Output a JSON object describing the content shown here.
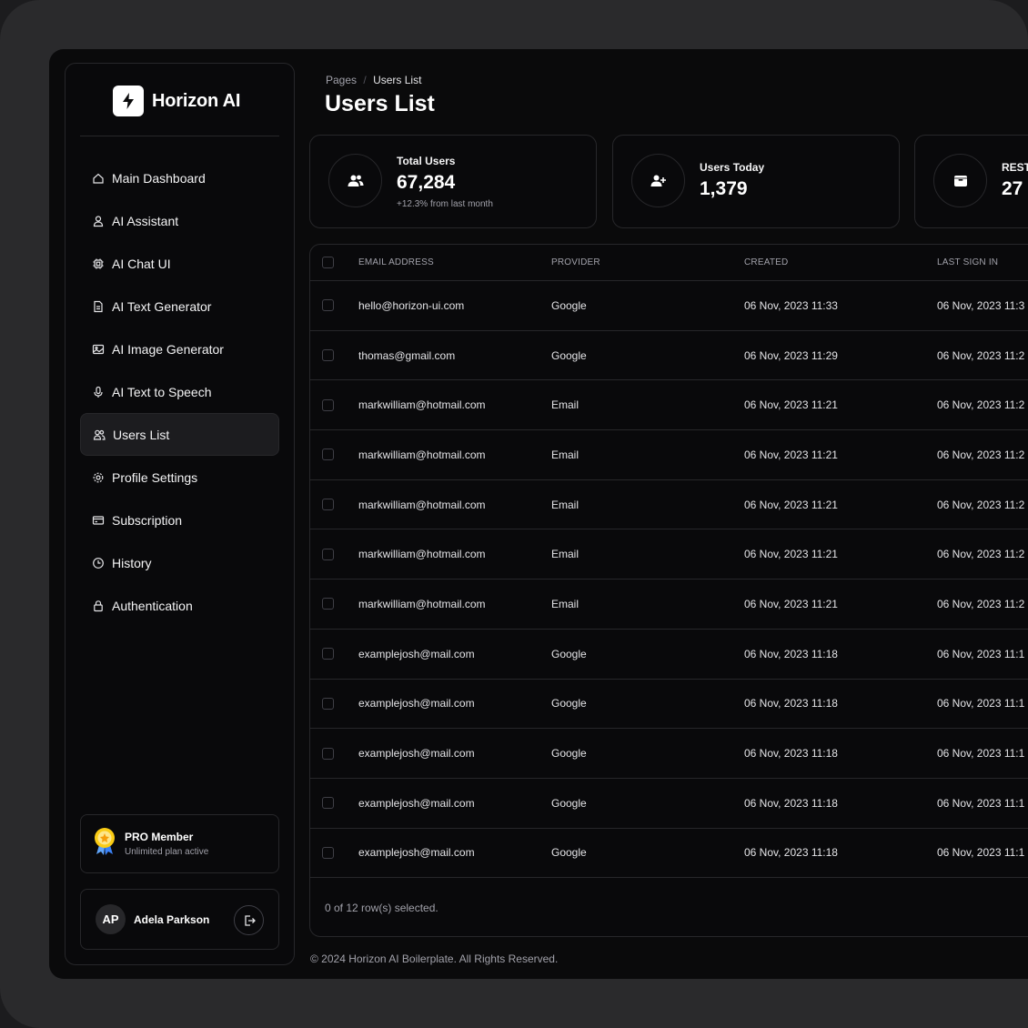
{
  "brand": {
    "name": "Horizon AI"
  },
  "nav": [
    {
      "label": "Main Dashboard",
      "icon": "home-icon"
    },
    {
      "label": "AI Assistant",
      "icon": "user-icon"
    },
    {
      "label": "AI Chat UI",
      "icon": "chip-icon"
    },
    {
      "label": "AI Text Generator",
      "icon": "document-icon"
    },
    {
      "label": "AI Image Generator",
      "icon": "image-icon"
    },
    {
      "label": "AI Text to Speech",
      "icon": "microphone-icon"
    },
    {
      "label": "Users List",
      "icon": "users-icon",
      "active": true
    },
    {
      "label": "Profile Settings",
      "icon": "gear-icon"
    },
    {
      "label": "Subscription",
      "icon": "credit-card-icon"
    },
    {
      "label": "History",
      "icon": "clock-icon"
    },
    {
      "label": "Authentication",
      "icon": "lock-icon"
    }
  ],
  "pro": {
    "title": "PRO Member",
    "subtitle": "Unlimited plan active"
  },
  "user": {
    "initials": "AP",
    "name": "Adela Parkson"
  },
  "breadcrumb": {
    "root": "Pages",
    "separator": "/",
    "current": "Users List"
  },
  "page_title": "Users List",
  "stats": [
    {
      "label": "Total Users",
      "value": "67,284",
      "sub": "+12.3% from last month",
      "icon": "users-icon"
    },
    {
      "label": "Users Today",
      "value": "1,379",
      "icon": "user-plus-icon"
    },
    {
      "label": "REST",
      "value": "27",
      "icon": "archive-icon"
    }
  ],
  "table": {
    "columns": [
      "EMAIL ADDRESS",
      "PROVIDER",
      "CREATED",
      "LAST SIGN IN"
    ],
    "rows": [
      [
        "hello@horizon-ui.com",
        "Google",
        "06 Nov, 2023 11:33",
        "06 Nov, 2023 11:3"
      ],
      [
        "thomas@gmail.com",
        "Google",
        "06 Nov, 2023 11:29",
        "06 Nov, 2023 11:2"
      ],
      [
        "markwilliam@hotmail.com",
        "Email",
        "06 Nov, 2023 11:21",
        "06 Nov, 2023 11:2"
      ],
      [
        "markwilliam@hotmail.com",
        "Email",
        "06 Nov, 2023 11:21",
        "06 Nov, 2023 11:2"
      ],
      [
        "markwilliam@hotmail.com",
        "Email",
        "06 Nov, 2023 11:21",
        "06 Nov, 2023 11:2"
      ],
      [
        "markwilliam@hotmail.com",
        "Email",
        "06 Nov, 2023 11:21",
        "06 Nov, 2023 11:2"
      ],
      [
        "markwilliam@hotmail.com",
        "Email",
        "06 Nov, 2023 11:21",
        "06 Nov, 2023 11:2"
      ],
      [
        "examplejosh@mail.com",
        "Google",
        "06 Nov, 2023 11:18",
        "06 Nov, 2023 11:1"
      ],
      [
        "examplejosh@mail.com",
        "Google",
        "06 Nov, 2023 11:18",
        "06 Nov, 2023 11:1"
      ],
      [
        "examplejosh@mail.com",
        "Google",
        "06 Nov, 2023 11:18",
        "06 Nov, 2023 11:1"
      ],
      [
        "examplejosh@mail.com",
        "Google",
        "06 Nov, 2023 11:18",
        "06 Nov, 2023 11:1"
      ],
      [
        "examplejosh@mail.com",
        "Google",
        "06 Nov, 2023 11:18",
        "06 Nov, 2023 11:1"
      ]
    ],
    "selection_status": "0 of 12 row(s) selected."
  },
  "footer": "© 2024 Horizon AI Boilerplate. All Rights Reserved."
}
